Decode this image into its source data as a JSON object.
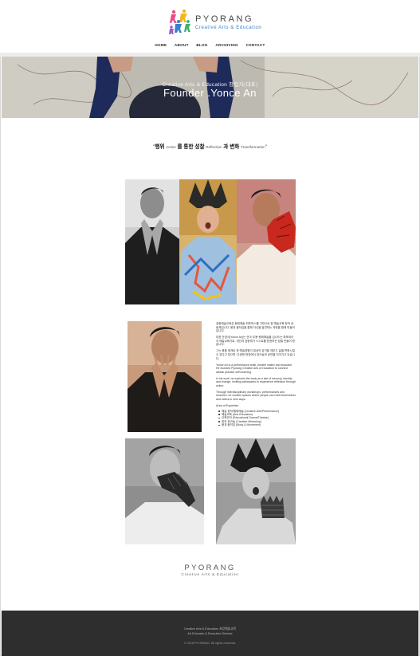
{
  "header": {
    "logo_title": "PYORANG",
    "logo_subtitle": "Creative Arts & Education",
    "nav": [
      "HOME",
      "ABOUT",
      "BLOG",
      "ARCHIVING",
      "CONTACT"
    ]
  },
  "hero": {
    "subtitle": "Creative Arts & Education 창립자(대표)",
    "title": "Founder .Yonce An"
  },
  "quote": {
    "open": "\"",
    "part1": "행위",
    "part1_en": "Action",
    "part2": "를 통한 성찰",
    "part2_en": "Reflection",
    "part3": "과 변화",
    "part3_en": "Transformation",
    "close": "\""
  },
  "bio": {
    "paragraphs": [
      "표랑예술교육은 행위예술·퍼포먼스를 기반으로 한 예술교육 창작 공동체입니다. 몸과 움직임을 통해 자신을 발견하는 과정을 함께 만들어갑니다.",
      "대표 안영서(Yonce An)는 연극·무용·행위예술을 넘나드는 퍼포머이자 예술교육가로, 개인과 공동체가 스스로를 표현하는 장을 만들어 왔습니다.",
      "그는 몸을 매개로 한 예술경험이 일상의 감각을 깨우고 삶을 변화시킬 수 있다고 믿으며, 다양한 현장에서 워크숍과 공연을 이어가고 있습니다.",
      "Yonce An is a performance artist, theatre maker and educator. He founded Pyorang Creative Arts & Education to connect artistic practice with learning.",
      "In his work, he explores the body as a site of memory, identity and change, inviting participants to experience reflection through action.",
      "Through interdisciplinary workshops, performances and research, he creates spaces where people can meet themselves and others in new ways."
    ],
    "area_title": "Area of Expertise",
    "areas": [
      "예술 창작/행위예술 (Creative Arts/Performance)",
      "예술교육 (Arts Education)",
      "교육연극 (Educational Drama/Theatre)",
      "창의 워크숍 (Creative Workshop)",
      "몸과 움직임 (Body & Movement)"
    ]
  },
  "footer_logo": {
    "title": "PYORANG",
    "subtitle": "Creative Arts & Education"
  },
  "footer": {
    "line1": "Creative Arts & Education 표랑예술교육",
    "line2": "Art Educator & Executive Director",
    "line3": "© 2016 PYORANG. All rights reserved."
  },
  "colors": {
    "accent_blue": "#3b80c9",
    "footer_bg": "#2e2e2e",
    "glove_red": "#c9281f",
    "nav_text": "#222222"
  }
}
